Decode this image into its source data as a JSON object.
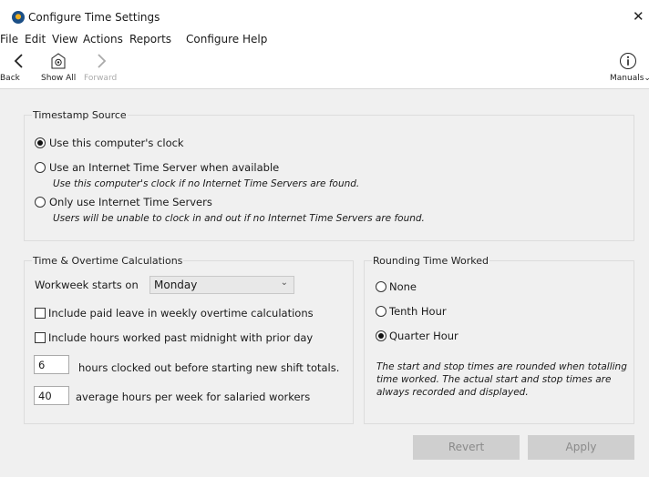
{
  "window": {
    "title": "Configure Time Settings",
    "close_glyph": "✕"
  },
  "menu": [
    "File",
    "Edit",
    "View",
    "Actions",
    "Reports",
    "Configure",
    "Help"
  ],
  "toolbar": {
    "back_label": "Back",
    "show_all_label": "Show All",
    "forward_label": "Forward",
    "manuals_label": "Manuals",
    "manuals_chevron": "⌄"
  },
  "timestamp": {
    "title": "Timestamp Source",
    "opt_computer": "Use this computer's clock",
    "opt_internet": "Use an Internet Time Server when available",
    "opt_internet_note": "Use this computer's clock if no Internet Time Servers are found.",
    "opt_only": "Only use Internet Time Servers",
    "opt_only_note": "Users will be unable to clock in and out if no Internet Time Servers are found.",
    "selected": "computer"
  },
  "overtime": {
    "title": "Time & Overtime Calculations",
    "workweek_label": "Workweek starts on",
    "workweek_value": "Monday",
    "chk_paid_leave": "Include paid leave in weekly overtime calculations",
    "chk_midnight": "Include hours worked past midnight with prior day",
    "shift_value": "6",
    "shift_label": "hours clocked out before starting new shift totals.",
    "salaried_value": "40",
    "salaried_label": "average hours per week for salaried workers"
  },
  "rounding": {
    "title": "Rounding Time Worked",
    "opt_none": "None",
    "opt_tenth": "Tenth Hour",
    "opt_quarter": "Quarter Hour",
    "selected": "quarter",
    "note": "The start and stop times are rounded when totalling time worked. The actual start and stop times are always recorded and displayed."
  },
  "buttons": {
    "revert": "Revert",
    "apply": "Apply"
  },
  "colors": {
    "app_icon_outer": "#1b4f86",
    "app_icon_inner": "#f0b020",
    "disabled_button": "#cfcfcf"
  }
}
